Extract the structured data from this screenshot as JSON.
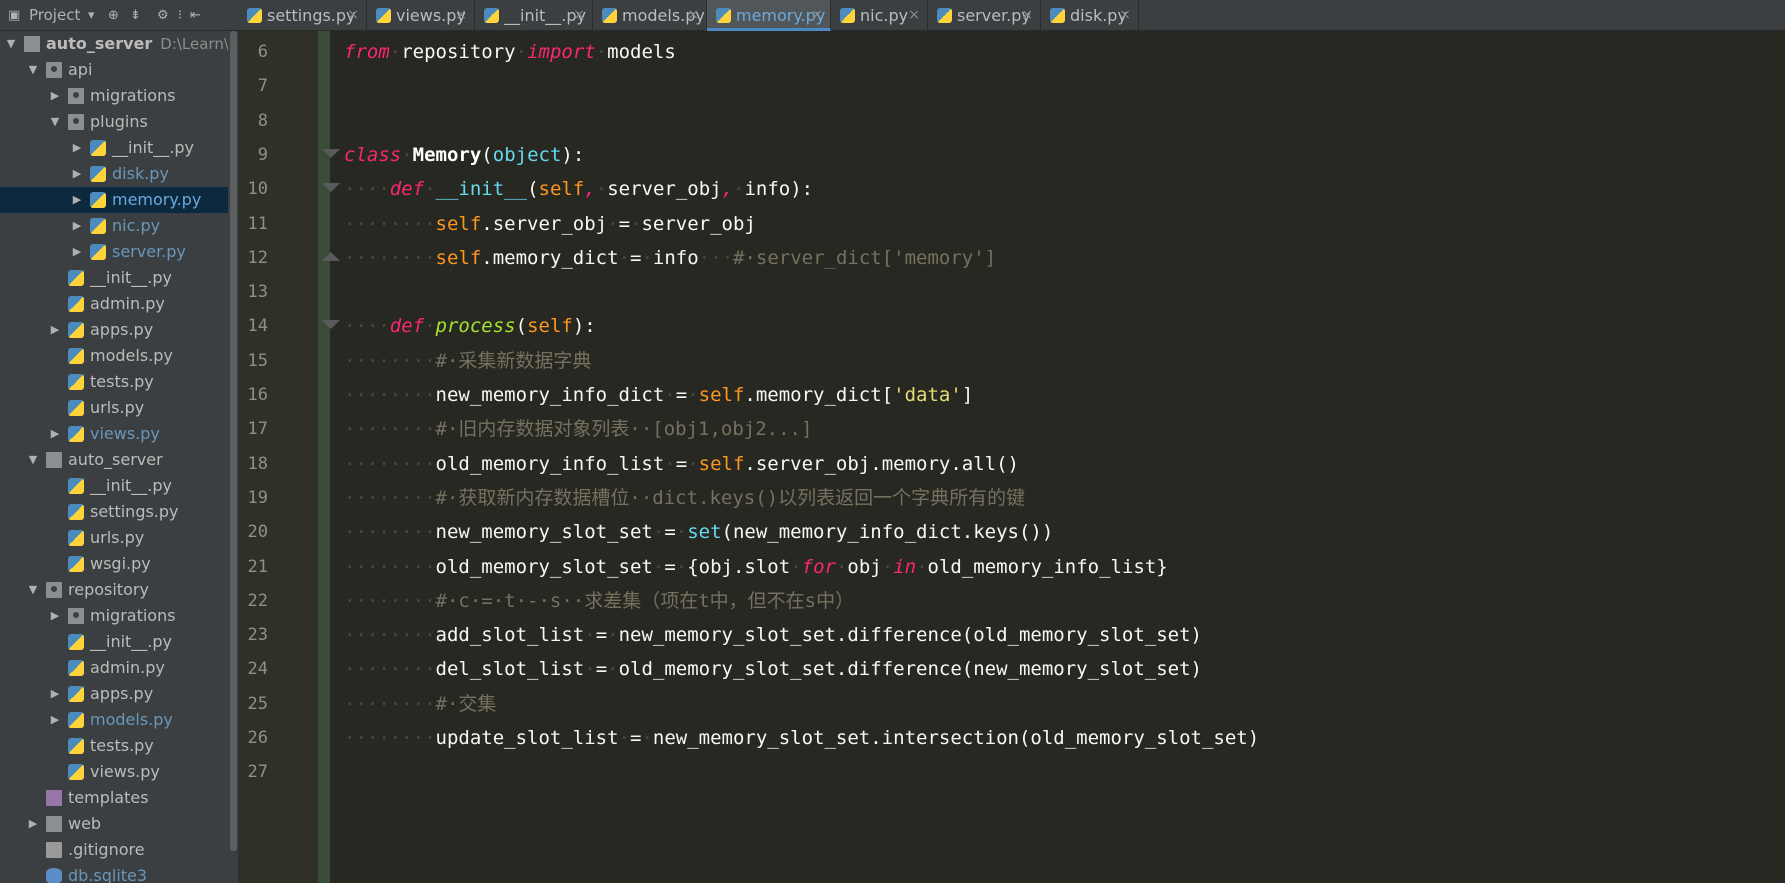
{
  "project_toolbar": {
    "project_label": "Project",
    "dropdown_icon": "chevron-down-icon",
    "icons": [
      "scroll-from-source-icon",
      "collapse-all-icon",
      "settings-gear-icon",
      "hide-panel-icon"
    ]
  },
  "tree": [
    {
      "name": "auto_server",
      "hint": "D:\\Learn\\P",
      "depth": 0,
      "arrow": "open",
      "icon": "folder",
      "bold": true
    },
    {
      "name": "api",
      "depth": 1,
      "arrow": "open",
      "icon": "folder-dot"
    },
    {
      "name": "migrations",
      "depth": 2,
      "arrow": "closed",
      "icon": "folder-dot"
    },
    {
      "name": "plugins",
      "depth": 2,
      "arrow": "open",
      "icon": "folder-dot"
    },
    {
      "name": "__init__.py",
      "depth": 3,
      "arrow": "closed",
      "icon": "py"
    },
    {
      "name": "disk.py",
      "depth": 3,
      "arrow": "closed",
      "icon": "py",
      "vcs": true
    },
    {
      "name": "memory.py",
      "depth": 3,
      "arrow": "closed",
      "icon": "py",
      "vcs": true,
      "selected": true
    },
    {
      "name": "nic.py",
      "depth": 3,
      "arrow": "closed",
      "icon": "py",
      "vcs": true
    },
    {
      "name": "server.py",
      "depth": 3,
      "arrow": "closed",
      "icon": "py",
      "vcs": true
    },
    {
      "name": "__init__.py",
      "depth": 2,
      "icon": "py"
    },
    {
      "name": "admin.py",
      "depth": 2,
      "icon": "py"
    },
    {
      "name": "apps.py",
      "depth": 2,
      "arrow": "closed",
      "icon": "py"
    },
    {
      "name": "models.py",
      "depth": 2,
      "icon": "py"
    },
    {
      "name": "tests.py",
      "depth": 2,
      "icon": "py"
    },
    {
      "name": "urls.py",
      "depth": 2,
      "icon": "py"
    },
    {
      "name": "views.py",
      "depth": 2,
      "arrow": "closed",
      "icon": "py",
      "vcs": true
    },
    {
      "name": "auto_server",
      "depth": 1,
      "arrow": "open",
      "icon": "folder"
    },
    {
      "name": "__init__.py",
      "depth": 2,
      "icon": "py"
    },
    {
      "name": "settings.py",
      "depth": 2,
      "icon": "py"
    },
    {
      "name": "urls.py",
      "depth": 2,
      "icon": "py"
    },
    {
      "name": "wsgi.py",
      "depth": 2,
      "icon": "py"
    },
    {
      "name": "repository",
      "depth": 1,
      "arrow": "open",
      "icon": "folder-dot"
    },
    {
      "name": "migrations",
      "depth": 2,
      "arrow": "closed",
      "icon": "folder-dot"
    },
    {
      "name": "__init__.py",
      "depth": 2,
      "icon": "py"
    },
    {
      "name": "admin.py",
      "depth": 2,
      "icon": "py"
    },
    {
      "name": "apps.py",
      "depth": 2,
      "arrow": "closed",
      "icon": "py"
    },
    {
      "name": "models.py",
      "depth": 2,
      "arrow": "closed",
      "icon": "py",
      "vcs": true
    },
    {
      "name": "tests.py",
      "depth": 2,
      "icon": "py"
    },
    {
      "name": "views.py",
      "depth": 2,
      "icon": "py"
    },
    {
      "name": "templates",
      "depth": 1,
      "icon": "folder-purple"
    },
    {
      "name": "web",
      "depth": 1,
      "arrow": "closed",
      "icon": "folder"
    },
    {
      "name": ".gitignore",
      "depth": 1,
      "icon": "file"
    },
    {
      "name": "db.sqlite3",
      "depth": 1,
      "icon": "db",
      "vcs": true
    }
  ],
  "tabs": [
    {
      "label": "settings.py",
      "close": "×"
    },
    {
      "label": "views.py",
      "close": "×"
    },
    {
      "label": "__init__.py",
      "close": "×"
    },
    {
      "label": "models.py",
      "close": "×"
    },
    {
      "label": "memory.py",
      "close": "×",
      "active": true
    },
    {
      "label": "nic.py",
      "close": "×"
    },
    {
      "label": "server.py",
      "close": "×"
    },
    {
      "label": "disk.py",
      "close": "×"
    }
  ],
  "code_lines": [
    {
      "num": "6",
      "fold": null,
      "tokens": [
        [
          "kw",
          "from"
        ],
        [
          "ws",
          "·"
        ],
        [
          "pun",
          "repository"
        ],
        [
          "ws",
          "·"
        ],
        [
          "kw",
          "import"
        ],
        [
          "ws",
          "·"
        ],
        [
          "pun",
          "models"
        ]
      ]
    },
    {
      "num": "7",
      "fold": null,
      "tokens": []
    },
    {
      "num": "8",
      "fold": null,
      "tokens": []
    },
    {
      "num": "9",
      "fold": "open",
      "tokens": [
        [
          "kw",
          "class"
        ],
        [
          "ws",
          "·"
        ],
        [
          "cls",
          "Memory"
        ],
        [
          "pun",
          "("
        ],
        [
          "bi",
          "object"
        ],
        [
          "pun",
          "):"
        ]
      ]
    },
    {
      "num": "10",
      "fold": "open",
      "tokens": [
        [
          "ws",
          "····"
        ],
        [
          "kw",
          "def"
        ],
        [
          "ws",
          "·"
        ],
        [
          "bi",
          "__init__"
        ],
        [
          "pun",
          "("
        ],
        [
          "slf",
          "self"
        ],
        [
          "kw",
          ","
        ],
        [
          "ws",
          "·"
        ],
        [
          "pun",
          "server_obj"
        ],
        [
          "kw",
          ","
        ],
        [
          "ws",
          "·"
        ],
        [
          "pun",
          "info):"
        ]
      ]
    },
    {
      "num": "11",
      "fold": null,
      "tokens": [
        [
          "ws",
          "········"
        ],
        [
          "slf",
          "self"
        ],
        [
          "pun",
          ".server_obj"
        ],
        [
          "ws",
          "·"
        ],
        [
          "pun",
          "="
        ],
        [
          "ws",
          "·"
        ],
        [
          "pun",
          "server_obj"
        ]
      ]
    },
    {
      "num": "12",
      "fold": "close",
      "tokens": [
        [
          "ws",
          "········"
        ],
        [
          "slf",
          "self"
        ],
        [
          "pun",
          ".memory_dict"
        ],
        [
          "ws",
          "·"
        ],
        [
          "pun",
          "="
        ],
        [
          "ws",
          "·"
        ],
        [
          "pun",
          "info"
        ],
        [
          "ws",
          "···"
        ],
        [
          "com",
          "#·server_dict['memory']"
        ]
      ]
    },
    {
      "num": "13",
      "fold": null,
      "tokens": []
    },
    {
      "num": "14",
      "fold": "open",
      "tokens": [
        [
          "ws",
          "····"
        ],
        [
          "kw",
          "def"
        ],
        [
          "ws",
          "·"
        ],
        [
          "fn",
          "process"
        ],
        [
          "pun",
          "("
        ],
        [
          "slf",
          "self"
        ],
        [
          "pun",
          "):"
        ]
      ]
    },
    {
      "num": "15",
      "fold": null,
      "tokens": [
        [
          "ws",
          "········"
        ],
        [
          "com",
          "#·采集新数据字典"
        ]
      ]
    },
    {
      "num": "16",
      "fold": null,
      "tokens": [
        [
          "ws",
          "········"
        ],
        [
          "pun",
          "new_memory_info_dict"
        ],
        [
          "ws",
          "·"
        ],
        [
          "pun",
          "="
        ],
        [
          "ws",
          "·"
        ],
        [
          "slf",
          "self"
        ],
        [
          "pun",
          ".memory_dict["
        ],
        [
          "str",
          "'data'"
        ],
        [
          "pun",
          "]"
        ]
      ]
    },
    {
      "num": "17",
      "fold": null,
      "tokens": [
        [
          "ws",
          "········"
        ],
        [
          "com",
          "#·旧内存数据对象列表··[obj1,obj2...]"
        ]
      ]
    },
    {
      "num": "18",
      "fold": null,
      "tokens": [
        [
          "ws",
          "········"
        ],
        [
          "pun",
          "old_memory_info_list"
        ],
        [
          "ws",
          "·"
        ],
        [
          "pun",
          "="
        ],
        [
          "ws",
          "·"
        ],
        [
          "slf",
          "self"
        ],
        [
          "pun",
          ".server_obj.memory.all()"
        ]
      ]
    },
    {
      "num": "19",
      "fold": null,
      "tokens": [
        [
          "ws",
          "········"
        ],
        [
          "com",
          "#·获取新内存数据槽位··dict.keys()以列表返回一个字典所有的键"
        ]
      ]
    },
    {
      "num": "20",
      "fold": null,
      "tokens": [
        [
          "ws",
          "········"
        ],
        [
          "pun",
          "new_memory_slot_set"
        ],
        [
          "ws",
          "·"
        ],
        [
          "pun",
          "="
        ],
        [
          "ws",
          "·"
        ],
        [
          "bi",
          "set"
        ],
        [
          "pun",
          "(new_memory_info_dict.keys())"
        ]
      ]
    },
    {
      "num": "21",
      "fold": null,
      "tokens": [
        [
          "ws",
          "········"
        ],
        [
          "pun",
          "old_memory_slot_set"
        ],
        [
          "ws",
          "·"
        ],
        [
          "pun",
          "="
        ],
        [
          "ws",
          "·"
        ],
        [
          "pun",
          "{obj.slot"
        ],
        [
          "ws",
          "·"
        ],
        [
          "kw",
          "for"
        ],
        [
          "ws",
          "·"
        ],
        [
          "pun",
          "obj"
        ],
        [
          "ws",
          "·"
        ],
        [
          "kw",
          "in"
        ],
        [
          "ws",
          "·"
        ],
        [
          "pun",
          "old_memory_info_list}"
        ]
      ]
    },
    {
      "num": "22",
      "fold": null,
      "tokens": [
        [
          "ws",
          "········"
        ],
        [
          "com",
          "#·c·=·t·-·s··求差集（项在t中，但不在s中）"
        ]
      ]
    },
    {
      "num": "23",
      "fold": null,
      "tokens": [
        [
          "ws",
          "········"
        ],
        [
          "pun",
          "add_slot_list"
        ],
        [
          "ws",
          "·"
        ],
        [
          "pun",
          "="
        ],
        [
          "ws",
          "·"
        ],
        [
          "pun",
          "new_memory_slot_set.difference(old_memory_slot_set)"
        ]
      ]
    },
    {
      "num": "24",
      "fold": null,
      "tokens": [
        [
          "ws",
          "········"
        ],
        [
          "pun",
          "del_slot_list"
        ],
        [
          "ws",
          "·"
        ],
        [
          "pun",
          "="
        ],
        [
          "ws",
          "·"
        ],
        [
          "pun",
          "old_memory_slot_set.difference(new_memory_slot_set)"
        ]
      ]
    },
    {
      "num": "25",
      "fold": null,
      "tokens": [
        [
          "ws",
          "········"
        ],
        [
          "com",
          "#·交集"
        ]
      ]
    },
    {
      "num": "26",
      "fold": null,
      "tokens": [
        [
          "ws",
          "········"
        ],
        [
          "pun",
          "update_slot_list"
        ],
        [
          "ws",
          "·"
        ],
        [
          "pun",
          "="
        ],
        [
          "ws",
          "·"
        ],
        [
          "pun",
          "new_memory_slot_set.intersection(old_memory_slot_set)"
        ]
      ]
    },
    {
      "num": "27",
      "fold": null,
      "tokens": []
    }
  ],
  "colors": {
    "editor_bg": "#272822",
    "panel_bg": "#3c3f41",
    "selection_bg": "#0d293e",
    "keyword": "#f92672",
    "builtin": "#66d9ef",
    "self": "#fd971f",
    "comment": "#75715e",
    "string": "#e6db74",
    "function": "#a6e22e",
    "vcs_modified": "#6897bb",
    "active_tab_accent": "#4a88c7"
  }
}
